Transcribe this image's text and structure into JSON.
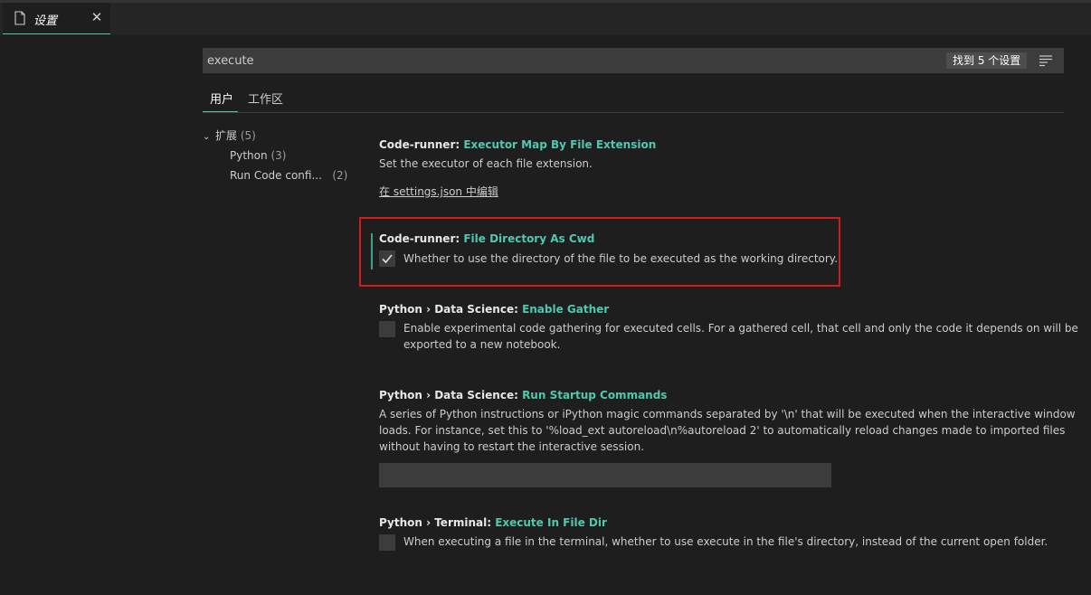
{
  "tab": {
    "title": "设置",
    "icon": "file-icon",
    "close": "✕"
  },
  "search": {
    "value": "execute",
    "placeholder": "",
    "result_count": "找到 5 个设置"
  },
  "scopes": [
    {
      "label": "用户"
    },
    {
      "label": "工作区"
    }
  ],
  "toc": [
    {
      "label": "扩展",
      "count": "(5)"
    },
    {
      "label": "Python",
      "count": "(3)"
    },
    {
      "label": "Run Code confi...",
      "count": "(2)"
    }
  ],
  "settings": [
    {
      "category": "Code-runner: ",
      "key": "Executor Map By File Extension",
      "description": "Set the executor of each file extension.",
      "link": "在 settings.json 中编辑"
    },
    {
      "category": "Code-runner: ",
      "key": "File Directory As Cwd",
      "description": "Whether to use the directory of the file to be executed as the working directory.",
      "checked": true
    },
    {
      "category": "Python › Data Science: ",
      "key": "Enable Gather",
      "description_line1": "Enable experimental code gathering for executed cells. For a gathered cell, that cell and only the code it depends on will be",
      "description_line2": "exported to a new notebook.",
      "checked": false
    },
    {
      "category": "Python › Data Science: ",
      "key": "Run Startup Commands",
      "description_line1": "A series of Python instructions or iPython magic commands separated by '\\n' that will be executed when the interactive window",
      "description_line2": "loads. For instance, set this to '%load_ext autoreload\\n%autoreload 2' to automatically reload changes made to imported files",
      "description_line3": "without having to restart the interactive session.",
      "value": ""
    },
    {
      "category": "Python › Terminal: ",
      "key": "Execute In File Dir",
      "description": "When executing a file in the terminal, whether to use execute in the file's directory, instead of the current open folder.",
      "checked": false
    }
  ],
  "colors": {
    "accent": "#4ec9b0",
    "highlight": "#d61a1a",
    "background": "#1e1e1e"
  }
}
